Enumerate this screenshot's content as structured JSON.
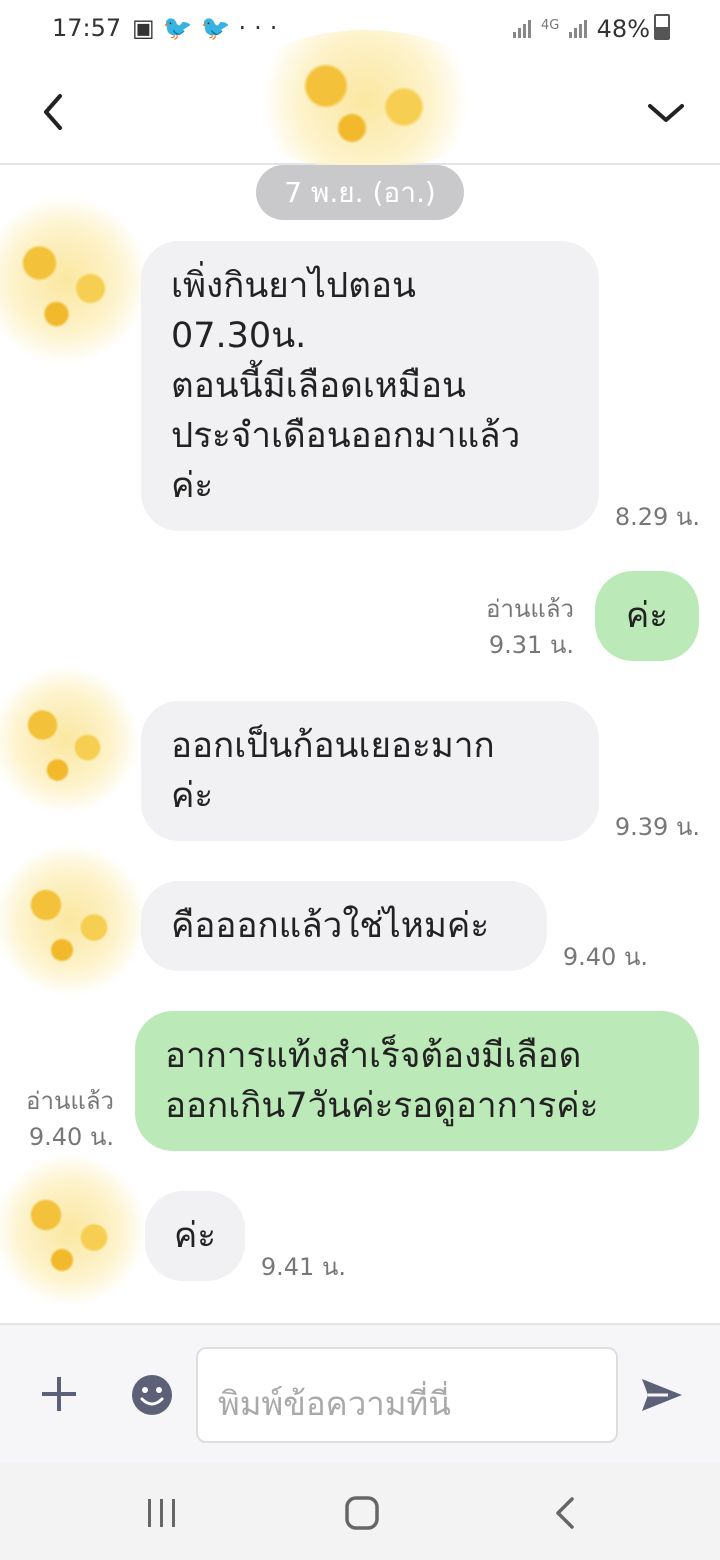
{
  "status_bar": {
    "time": "17:57",
    "notification_icons": [
      "gallery-icon",
      "twitter-icon",
      "twitter-icon",
      "more-icon"
    ],
    "network": "4G",
    "battery": "48%"
  },
  "chat": {
    "date_separator": "7 พ.ย. (อา.)",
    "messages": [
      {
        "side": "in",
        "lines": [
          "เพิ่งกินยาไปตอน",
          "07.30น.",
          "ตอนนี้มีเลือดเหมือน",
          "ประจำเดือนออกมาแล้ว",
          "ค่ะ"
        ],
        "time": "8.29 น."
      },
      {
        "side": "out",
        "lines": [
          "ค่ะ"
        ],
        "read": "อ่านแล้ว",
        "time": "9.31 น."
      },
      {
        "side": "in",
        "lines": [
          "ออกเป็นก้อนเยอะมาก",
          "ค่ะ"
        ],
        "time": "9.39 น."
      },
      {
        "side": "in",
        "lines": [
          "คือออกแล้วใช่ไหมค่ะ"
        ],
        "time": "9.40 น."
      },
      {
        "side": "out",
        "lines": [
          "อาการแท้งสำเร็จต้องมีเลือด",
          "ออกเกิน7วันค่ะรอดูอาการค่ะ"
        ],
        "read": "อ่านแล้ว",
        "time": "9.40 น."
      },
      {
        "side": "in",
        "lines": [
          "ค่ะ"
        ],
        "time": "9.41 น."
      }
    ]
  },
  "composer": {
    "placeholder": "พิมพ์ข้อความที่นี่"
  },
  "colors": {
    "incoming_bubble": "#f1f1f3",
    "outgoing_bubble": "#bce9b8",
    "icon_gray": "#5c6178",
    "date_pill": "#c9c9cb"
  }
}
